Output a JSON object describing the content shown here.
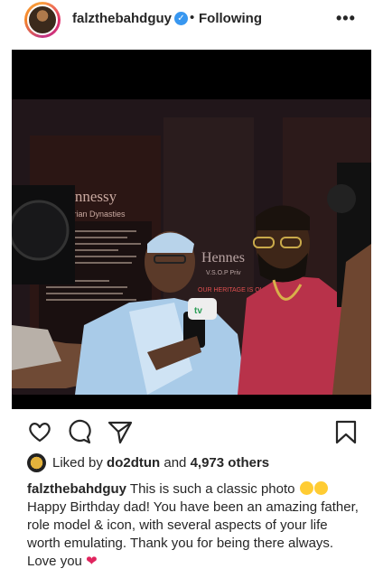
{
  "post": {
    "username": "falzthebahdguy",
    "separator": "•",
    "follow_status": "Following",
    "more": "•••"
  },
  "actions": {
    "like": "heart-icon",
    "comment": "comment-icon",
    "share": "share-icon",
    "save": "bookmark-icon"
  },
  "likes": {
    "prefix": "Liked by",
    "user": "do2dtun",
    "middle": "and",
    "others": "4,973 others"
  },
  "caption": {
    "username": "falzthebahdguy",
    "line1": "This is such a classic photo",
    "body": "Happy Birthday dad! You have been an amazing father, role model & icon, with several aspects of your life worth emulating. Thank you for being there always. Love you"
  },
  "photo_text": {
    "brand": "Hennessy",
    "subtitle": "Nigerian Dynasties",
    "brand2": "Hennes",
    "vsop": "V.S.O.P Priv",
    "heritage": "OUR HERITAGE IS OUR FIRE",
    "mic_label": "tv"
  },
  "colors": {
    "verified": "#3897f0",
    "heart": "#e0245e",
    "text": "#262626"
  }
}
